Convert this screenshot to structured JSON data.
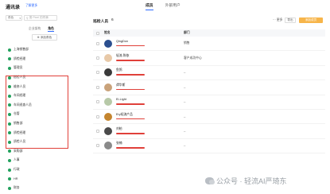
{
  "header": {
    "title": "通讯录",
    "subtitle": "了解更多",
    "tabs": [
      {
        "label": "成员",
        "active": true
      },
      {
        "label": "外部用户",
        "active": false
      }
    ]
  },
  "left": {
    "scope_select": "角色",
    "search_placeholder": "搜 Pixel 的同事",
    "tabs": [
      {
        "label": "企业架构"
      },
      {
        "label": "角色",
        "active": true
      }
    ],
    "add_role_label": "添加角色",
    "roles": [
      "上海销售部",
      "质检经理",
      "管理员",
      "巡检人员",
      "维修人员",
      "车间经理",
      "车间巡查人员",
      "仓管",
      "销售部",
      "质检经理",
      "质检人员",
      "采购部",
      "人事",
      "行政",
      "HR",
      "财务"
    ]
  },
  "main": {
    "title": "巡检人员",
    "count": "6",
    "more_label": "更多",
    "export_label": "导出",
    "add_member_label": "添加成员",
    "columns": {
      "name": "姓名",
      "department": "部门"
    },
    "rows": [
      {
        "name": "QingDon",
        "dept": "销售"
      },
      {
        "name": "轻流-陈依",
        "dept": "客户成功中心"
      },
      {
        "name": "鱼鸽",
        "dept": "--"
      },
      {
        "name": "谭华斯",
        "dept": "--"
      },
      {
        "name": "Ei-Light",
        "dept": "--"
      },
      {
        "name": "Ery轻流产品",
        "dept": "--"
      },
      {
        "name": "刘柏",
        "dept": "--"
      },
      {
        "name": "张楠",
        "dept": "--"
      }
    ]
  },
  "watermark": "公众号 · 轻流AI严琦东",
  "colors": {
    "accent": "#2f6bff",
    "add_button": "#f7b54a",
    "role_icon": "#21a15c",
    "highlight": "#e0403a"
  },
  "avatar_colors": [
    "#2b4f8f",
    "#e8c9a8",
    "#3a3a3a",
    "#c9a27a",
    "#b7c9a8",
    "#c4852f",
    "#4a4a4a",
    "#8a8a8a"
  ]
}
